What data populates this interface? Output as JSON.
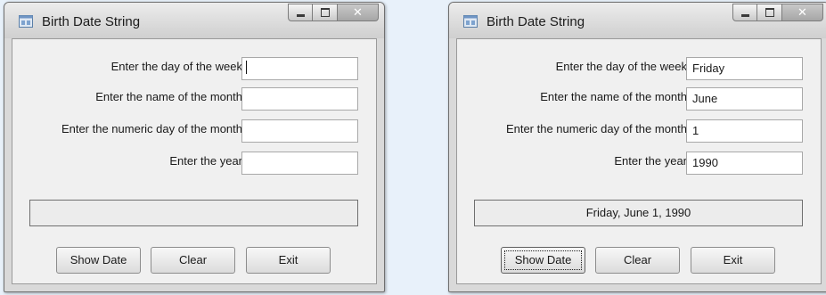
{
  "windows": [
    {
      "title": "Birth Date String",
      "labels": {
        "day_of_week": "Enter the day of the week",
        "month_name": "Enter the name of the month",
        "numeric_day": "Enter the numeric day of the month",
        "year": "Enter the year"
      },
      "values": {
        "day_of_week": "",
        "month_name": "",
        "numeric_day": "",
        "year": ""
      },
      "output": "",
      "buttons": {
        "show_date": "Show Date",
        "clear": "Clear",
        "exit": "Exit"
      }
    },
    {
      "title": "Birth Date String",
      "labels": {
        "day_of_week": "Enter the day of the week",
        "month_name": "Enter the name of the month",
        "numeric_day": "Enter the numeric day of the month",
        "year": "Enter the year"
      },
      "values": {
        "day_of_week": "Friday",
        "month_name": "June",
        "numeric_day": "1",
        "year": "1990"
      },
      "output": "Friday, June 1, 1990",
      "buttons": {
        "show_date": "Show Date",
        "clear": "Clear",
        "exit": "Exit"
      }
    }
  ],
  "colors": {
    "page_background": "#e8f1fa",
    "window_frame": "#d9d9d9",
    "client_area": "#f0f0f0",
    "close_button": "#b5b5b5"
  },
  "icons": [
    "app-icon",
    "minimize-icon",
    "maximize-icon",
    "close-icon"
  ]
}
